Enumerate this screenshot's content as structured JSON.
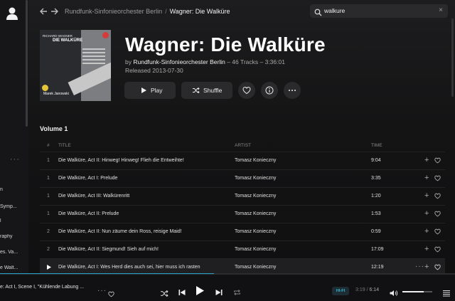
{
  "sidebar": {
    "dots": "···",
    "items": [
      {
        "label": "n"
      },
      {
        "label": "Symp..."
      },
      {
        "label": "l"
      },
      {
        "label": "raphy"
      },
      {
        "label": "es. Va..."
      },
      {
        "label": "e Walt..."
      }
    ]
  },
  "header": {
    "breadcrumb_parent": "Rundfunk-Sinfonieorchester Berlin",
    "breadcrumb_sep": "/",
    "breadcrumb_current": "Wagner: Die Walküre"
  },
  "search": {
    "value": "walkure",
    "clear": "×"
  },
  "cover": {
    "composer": "RICHARD WAGNER",
    "title": "DIE WALKÜRE",
    "conductor": "Marek Janowski"
  },
  "album": {
    "title": "Wagner: Die Walküre",
    "by": "by",
    "artist": "Rundfunk-Sinfonieorchester Berlin",
    "meta": " – 46 Tracks – 3:36:01",
    "released": "Released 2013-07-30",
    "play_label": "Play",
    "shuffle_label": "Shuffle"
  },
  "volume_label": "Volume 1",
  "table": {
    "headers": {
      "num": "#",
      "title": "TITLE",
      "artist": "ARTIST",
      "time": "TIME"
    },
    "rows": [
      {
        "num": "1",
        "title": "Die Walküre, Act II: Hinweg! Hinweg! Flieh die Entweihte!",
        "artist": "Tomasz Konieczny",
        "time": "9:04"
      },
      {
        "num": "1",
        "title": "Die Walküre, Act I: Prelude",
        "artist": "Tomasz Konieczny",
        "time": "3:35"
      },
      {
        "num": "1",
        "title": "Die Walküre, Act III: Walkürenritt",
        "artist": "Tomasz Konieczny",
        "time": "1:20"
      },
      {
        "num": "1",
        "title": "Die Walküre, Act II: Prelude",
        "artist": "Tomasz Konieczny",
        "time": "1:53"
      },
      {
        "num": "2",
        "title": "Die Walküre, Act II: Nun zäume dein Ross, reisige Maid!",
        "artist": "Tomasz Konieczny",
        "time": "0:59"
      },
      {
        "num": "2",
        "title": "Die Walküre, Act II: Siegmund! Sieh auf mich!",
        "artist": "Tomasz Konieczny",
        "time": "17:09"
      },
      {
        "num": "",
        "title": "Die Walküre, Act I: Wes Herd dies auch sei, hier muss ich rasten",
        "artist": "Tomasz Konieczny",
        "time": "12:19"
      }
    ]
  },
  "player": {
    "now_playing": "e: Act I, Scene I, \"Kühlende Labung ...",
    "dots": "···",
    "quality": "HI-FI",
    "elapsed": "3:19",
    "separator": " / ",
    "duration": "6:14",
    "progress": 0.47,
    "volume": 0.72
  },
  "colors": {
    "accent": "#28a3c7",
    "background": "#0d0d0e"
  }
}
